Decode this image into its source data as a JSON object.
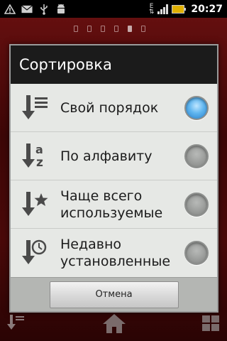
{
  "statusbar": {
    "time": "20:27",
    "network_type": "E",
    "icons": [
      "warning-icon",
      "email-icon",
      "usb-icon",
      "android-debug-icon",
      "data-e-icon",
      "signal-icon",
      "battery-charging-icon"
    ]
  },
  "home": {
    "pages": 6,
    "active_page": 5
  },
  "dialog": {
    "title": "Сортировка",
    "options": [
      {
        "label": "Свой порядок",
        "icon": "custom-order-icon",
        "checked": true
      },
      {
        "label": "По алфавиту",
        "icon": "alphabetical-icon",
        "checked": false
      },
      {
        "label": "Чаще всего используемые",
        "icon": "most-used-icon",
        "checked": false
      },
      {
        "label": "Недавно установленные",
        "icon": "recently-installed-icon",
        "checked": false
      }
    ],
    "cancel_label": "Отмена"
  },
  "colors": {
    "accent_radio": "#3a95dd",
    "title_bar": "#1b1b1b",
    "dialog_bg": "#e6e8e5",
    "wallpaper": "#4a0909"
  }
}
